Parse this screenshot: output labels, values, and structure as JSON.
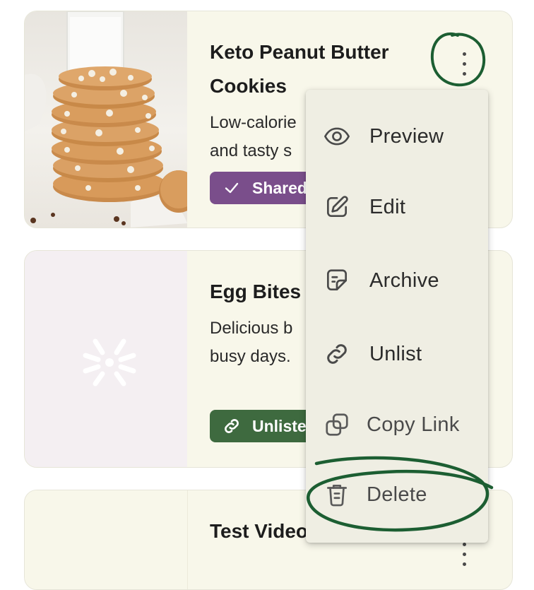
{
  "cards": [
    {
      "title": "Keto Peanut Butter Cookies",
      "description_lines": [
        "Low-calorie",
        "and tasty s"
      ],
      "badge": {
        "label": "Shared",
        "icon": "check-icon",
        "color": "#7a4e8b"
      }
    },
    {
      "title": "Egg Bites",
      "description_lines": [
        "Delicious b",
        "busy days."
      ],
      "badge": {
        "label": "Unlisted",
        "icon": "link-icon",
        "color": "#3e6a3f"
      }
    },
    {
      "title": "Test Video"
    }
  ],
  "menu": {
    "items": [
      {
        "label": "Preview",
        "icon": "eye-icon"
      },
      {
        "label": "Edit",
        "icon": "pencil-icon"
      },
      {
        "label": "Archive",
        "icon": "archive-note-icon"
      },
      {
        "label": "Unlist",
        "icon": "link-icon"
      },
      {
        "label": "Copy Link",
        "icon": "copy-icon"
      },
      {
        "label": "Delete",
        "icon": "trash-icon"
      }
    ]
  },
  "colors": {
    "card_bg": "#f8f7ea",
    "menu_bg": "#efeee3",
    "shared_badge": "#7a4e8b",
    "unlisted_badge": "#3e6a3f",
    "annotation": "#1c5e32"
  }
}
